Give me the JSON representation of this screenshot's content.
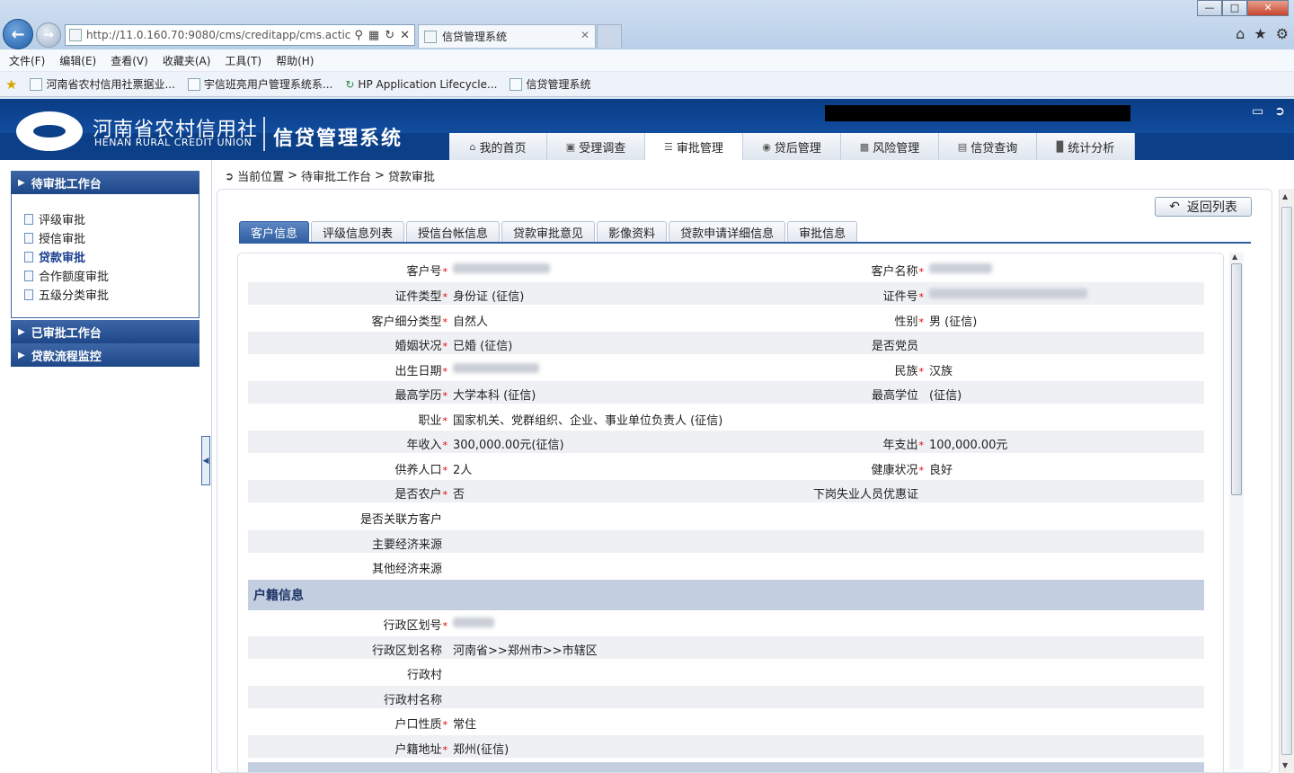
{
  "browser": {
    "url": "http://11.0.160.70:9080/cms/creditapp/cms.actic",
    "tab_title": "信贷管理系统",
    "menu": [
      "文件(F)",
      "编辑(E)",
      "查看(V)",
      "收藏夹(A)",
      "工具(T)",
      "帮助(H)"
    ],
    "favorites": [
      "河南省农村信用社票据业...",
      "宇信班亮用户管理系统系...",
      "HP Application Lifecycle...",
      "信贷管理系统"
    ]
  },
  "header": {
    "org_cn": "河南省农村信用社",
    "org_en": "HENAN RURAL CREDIT UNION",
    "system": "信贷管理系统",
    "nav": [
      "我的首页",
      "受理调查",
      "审批管理",
      "贷后管理",
      "风险管理",
      "信贷查询",
      "统计分析"
    ],
    "nav_active": "审批管理"
  },
  "sidebar": {
    "sections": [
      "待审批工作台",
      "已审批工作台",
      "贷款流程监控"
    ],
    "items": [
      "评级审批",
      "授信审批",
      "贷款审批",
      "合作额度审批",
      "五级分类审批"
    ],
    "active_item": "贷款审批"
  },
  "breadcrumb": [
    "当前位置",
    ">",
    "待审批工作台",
    ">",
    "贷款审批"
  ],
  "back_button": "返回列表",
  "tabs": [
    "客户信息",
    "评级信息列表",
    "授信台帐信息",
    "贷款审批意见",
    "影像资料",
    "贷款申请详细信息",
    "审批信息"
  ],
  "tabs_active": "客户信息",
  "form": {
    "customer_no": "客户号",
    "customer_name": "客户名称",
    "id_type": "证件类型",
    "id_type_val": "身份证 (征信)",
    "id_no": "证件号",
    "cust_sub_type": "客户细分类型",
    "cust_sub_type_val": "自然人",
    "gender": "性别",
    "gender_val": "男 (征信)",
    "marital": "婚姻状况",
    "marital_val": "已婚 (征信)",
    "party": "是否党员",
    "birth": "出生日期",
    "ethnic": "民族",
    "ethnic_val": "汉族",
    "edu": "最高学历",
    "edu_val": "大学本科 (征信)",
    "degree": "最高学位",
    "degree_val": "(征信)",
    "job": "职业",
    "job_val": "国家机关、党群组织、企业、事业单位负责人 (征信)",
    "income": "年收入",
    "income_val": "300,000.00元(征信)",
    "expense": "年支出",
    "expense_val": "100,000.00元",
    "dependents": "供养人口",
    "dependents_val": "2人",
    "health": "健康状况",
    "health_val": "良好",
    "farmer": "是否农户",
    "farmer_val": "否",
    "laid_off": "下岗失业人员优惠证",
    "related": "是否关联方客户",
    "main_src": "主要经济来源",
    "other_src": "其他经济来源",
    "section_huji": "户籍信息",
    "region_code": "行政区划号",
    "region_name": "行政区划名称",
    "region_name_val": "河南省>>郑州市>>市辖区",
    "village": "行政村",
    "village_name": "行政村名称",
    "hukou_type": "户口性质",
    "hukou_type_val": "常住",
    "hukou_addr": "户籍地址",
    "hukou_addr_val": "郑州(征信)"
  }
}
